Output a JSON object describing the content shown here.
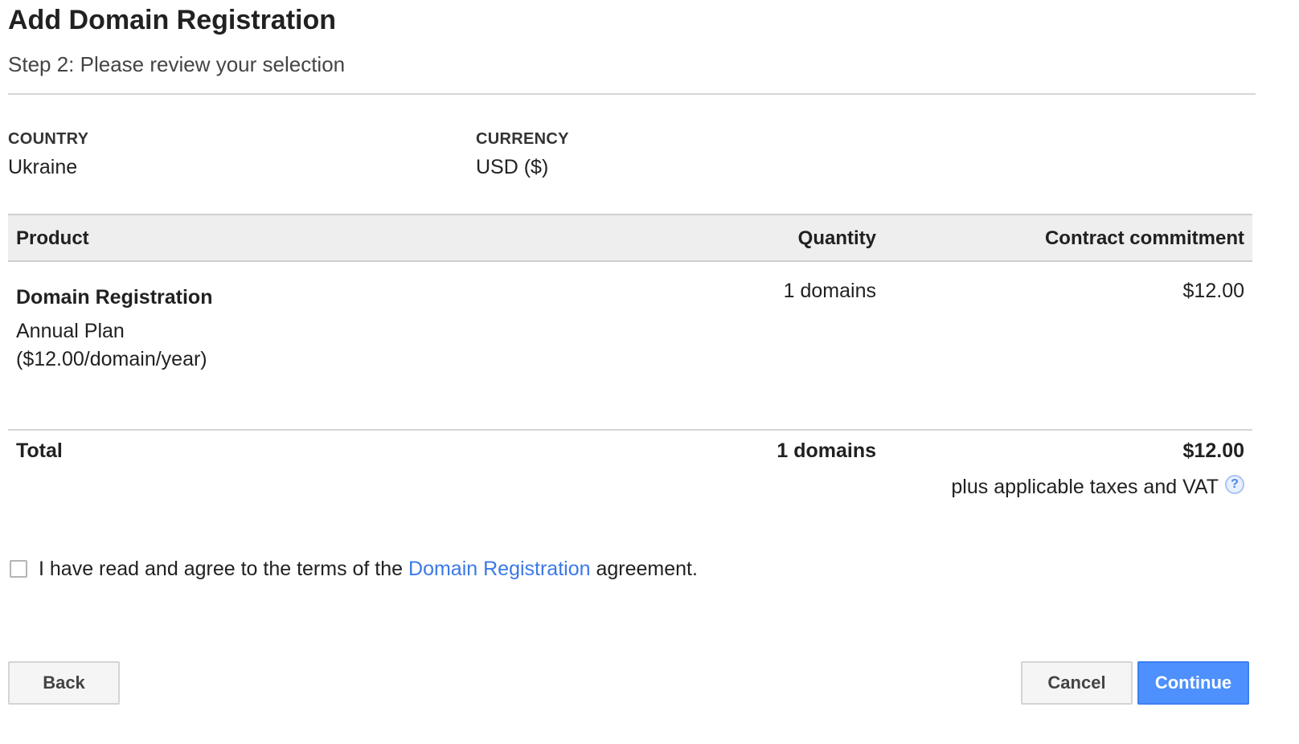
{
  "page": {
    "title": "Add Domain Registration",
    "subtitle": "Step 2: Please review your selection"
  },
  "meta": {
    "country_label": "COUNTRY",
    "country_value": "Ukraine",
    "currency_label": "CURRENCY",
    "currency_value": "USD ($)"
  },
  "table": {
    "headers": {
      "product": "Product",
      "quantity": "Quantity",
      "commitment": "Contract commitment"
    },
    "rows": [
      {
        "product_name": "Domain Registration",
        "plan_line1": "Annual Plan",
        "plan_line2": "($12.00/domain/year)",
        "quantity": "1 domains",
        "commitment": "$12.00"
      }
    ],
    "total": {
      "label": "Total",
      "quantity": "1 domains",
      "commitment": "$12.00",
      "tax_note": "plus applicable taxes and VAT",
      "help_icon_glyph": "?"
    }
  },
  "agreement": {
    "checked": false,
    "text_before": "I have read and agree to the terms of the ",
    "link_text": "Domain Registration",
    "text_after": " agreement."
  },
  "buttons": {
    "back": "Back",
    "cancel": "Cancel",
    "continue": "Continue"
  },
  "colors": {
    "primary": "#4d90fe",
    "link": "#3b78e7"
  }
}
